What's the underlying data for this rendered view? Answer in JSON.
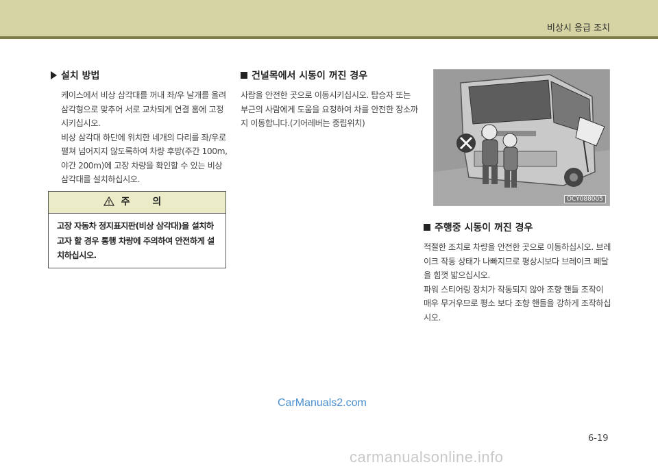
{
  "header": {
    "title": "비상시 응급 조치",
    "bg_color": "#d6d4a4",
    "line_color": "#7f7d46"
  },
  "install": {
    "title": "설치 방법",
    "paragraph1": "케이스에서 비상 삼각대를 꺼내 좌/우 날개를 올려 삼각형으로 맞추어 서로 교차되게 연결 홈에 고정시키십시오.",
    "paragraph2": "비상 삼각대 하단에 위치한 네개의 다리를 좌/우로 펼쳐 넘어지지 않도록하여 차량 후방(주간 100m, 야간 200m)에 고장 차량을 확인할 수 있는 비상 삼각대를 설치하십시오."
  },
  "caution": {
    "heading": "주 의",
    "icon": "warning-triangle-icon",
    "text": "고장 자동차 정지표지판(비상 삼각대)을 설치하고자 할 경우 통행 차량에 주의하여 안전하게 설치하십시오."
  },
  "railroad": {
    "title": "건널목에서 시동이 꺼진 경우",
    "text": "사람을 안전한 곳으로 이동시키십시오. 탑승자 또는 부근의 사람에게 도움을 요청하여 차를 안전한 장소까지 이동합니다.(기어레버는 중립위치)"
  },
  "figure": {
    "code": "OCY088005"
  },
  "driving": {
    "title": "주행중 시동이 꺼진 경우",
    "paragraph1": "적절한 조치로 차량을 안전한 곳으로 이동하십시오. 브레이크 작동 상태가 나빠지므로 평상시보다 브레이크 페달을 힘껏 밟으십시오.",
    "paragraph2": "파워 스티어링 장치가 작동되지 않아 조향 핸들 조작이 매우 무거우므로 평소 보다 조향 핸들을 강하게 조작하십시오."
  },
  "watermark": "CarManuals2.com",
  "page_number": "6-19",
  "footer_mark": "carmanualsonline.info"
}
